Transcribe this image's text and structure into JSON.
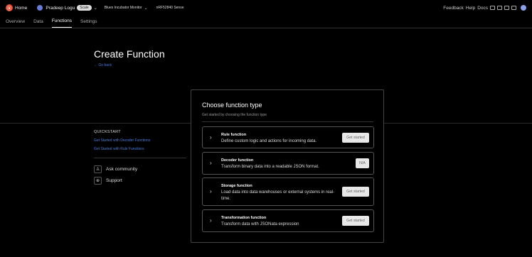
{
  "topbar": {
    "home": "Home",
    "user_name": "Pradeep Logu",
    "plan_badge": "Scale",
    "project": "Blues Incubator Monitor",
    "device": "nRF52840 Sense",
    "feedback": "Feedback",
    "help": "Help",
    "docs": "Docs"
  },
  "tabs": [
    "Overview",
    "Data",
    "Functions",
    "Settings"
  ],
  "page": {
    "title": "Create Function",
    "go_back": "← Go back"
  },
  "quickstart": {
    "title": "QUICKSTART",
    "links": [
      "Get Started with Decoder Functions",
      "Get Started with Rule Functions"
    ],
    "ask_community": "Ask community",
    "support": "Support"
  },
  "panel": {
    "title": "Choose function type",
    "subtitle": "Get started by choosing the function type",
    "cards": [
      {
        "title": "Rule function",
        "desc": "Define custom logic and actions for incoming data.",
        "button": "Get started"
      },
      {
        "title": "Decoder function",
        "desc": "Transform binary data into a readable JSON format.",
        "button": "N/A"
      },
      {
        "title": "Storage function",
        "desc": "Load data into data warehouses or external systems in real-time.",
        "button": "Get started"
      },
      {
        "title": "Transformation function",
        "desc": "Transform data with JSONata expression",
        "button": "Get started"
      }
    ]
  }
}
